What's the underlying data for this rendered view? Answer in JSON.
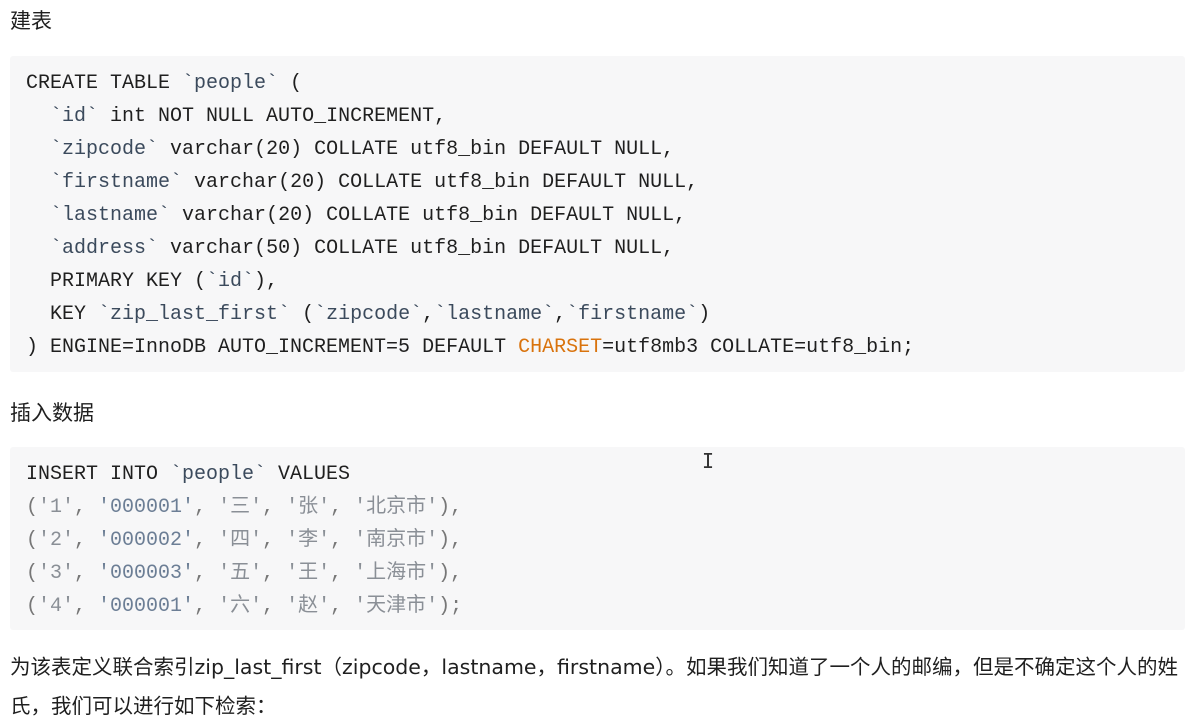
{
  "heading1": "建表",
  "code1": [
    [
      [
        "CREATE TABLE ",
        "k"
      ],
      [
        "`people`",
        "n"
      ],
      [
        " (",
        "k"
      ]
    ],
    [
      [
        "  ",
        "k"
      ],
      [
        "`id`",
        "n"
      ],
      [
        " int NOT NULL AUTO_INCREMENT,",
        "k"
      ]
    ],
    [
      [
        "  ",
        "k"
      ],
      [
        "`zipcode`",
        "n"
      ],
      [
        " varchar(20) COLLATE utf8_bin DEFAULT NULL,",
        "k"
      ]
    ],
    [
      [
        "  ",
        "k"
      ],
      [
        "`firstname`",
        "n"
      ],
      [
        " varchar(20) COLLATE utf8_bin DEFAULT NULL,",
        "k"
      ]
    ],
    [
      [
        "  ",
        "k"
      ],
      [
        "`lastname`",
        "n"
      ],
      [
        " varchar(20) COLLATE utf8_bin DEFAULT NULL,",
        "k"
      ]
    ],
    [
      [
        "  ",
        "k"
      ],
      [
        "`address`",
        "n"
      ],
      [
        " varchar(50) COLLATE utf8_bin DEFAULT NULL,",
        "k"
      ]
    ],
    [
      [
        "  PRIMARY KEY (",
        "k"
      ],
      [
        "`id`",
        "n"
      ],
      [
        "),",
        "k"
      ]
    ],
    [
      [
        "  KEY ",
        "k"
      ],
      [
        "`zip_last_first`",
        "n"
      ],
      [
        " (",
        "k"
      ],
      [
        "`zipcode`",
        "n"
      ],
      [
        ",",
        "k"
      ],
      [
        "`lastname`",
        "n"
      ],
      [
        ",",
        "k"
      ],
      [
        "`firstname`",
        "n"
      ],
      [
        ")",
        "k"
      ]
    ],
    [
      [
        ") ENGINE=InnoDB AUTO_INCREMENT=5 DEFAULT ",
        "k"
      ],
      [
        "CHARSET",
        "o"
      ],
      [
        "=utf8mb3 COLLATE=utf8_bin;",
        "k"
      ]
    ]
  ],
  "heading2": "插入数据",
  "code2": [
    [
      [
        "INSERT INTO ",
        "k"
      ],
      [
        "`people`",
        "n"
      ],
      [
        " VALUES",
        "k"
      ]
    ],
    [
      [
        "(",
        "p"
      ],
      [
        "'1'",
        "s"
      ],
      [
        ", ",
        "p"
      ],
      [
        "'000001'",
        "num"
      ],
      [
        ", ",
        "p"
      ],
      [
        "'三'",
        "s"
      ],
      [
        ", ",
        "p"
      ],
      [
        "'张'",
        "s"
      ],
      [
        ", ",
        "p"
      ],
      [
        "'北京市'",
        "s"
      ],
      [
        "),",
        "p"
      ]
    ],
    [
      [
        "(",
        "p"
      ],
      [
        "'2'",
        "s"
      ],
      [
        ", ",
        "p"
      ],
      [
        "'000002'",
        "num"
      ],
      [
        ", ",
        "p"
      ],
      [
        "'四'",
        "s"
      ],
      [
        ", ",
        "p"
      ],
      [
        "'李'",
        "s"
      ],
      [
        ", ",
        "p"
      ],
      [
        "'南京市'",
        "s"
      ],
      [
        "),",
        "p"
      ]
    ],
    [
      [
        "(",
        "p"
      ],
      [
        "'3'",
        "s"
      ],
      [
        ", ",
        "p"
      ],
      [
        "'000003'",
        "num"
      ],
      [
        ", ",
        "p"
      ],
      [
        "'五'",
        "s"
      ],
      [
        ", ",
        "p"
      ],
      [
        "'王'",
        "s"
      ],
      [
        ", ",
        "p"
      ],
      [
        "'上海市'",
        "s"
      ],
      [
        "),",
        "p"
      ]
    ],
    [
      [
        "(",
        "p"
      ],
      [
        "'4'",
        "s"
      ],
      [
        ", ",
        "p"
      ],
      [
        "'000001'",
        "num"
      ],
      [
        ", ",
        "p"
      ],
      [
        "'六'",
        "s"
      ],
      [
        ", ",
        "p"
      ],
      [
        "'赵'",
        "s"
      ],
      [
        ", ",
        "p"
      ],
      [
        "'天津市'",
        "s"
      ],
      [
        ");",
        "p"
      ]
    ]
  ],
  "paragraph": "为该表定义联合索引zip_last_first（zipcode，lastname，firstname）。如果我们知道了一个人的邮编，但是不确定这个人的姓氏，我们可以进行如下检索：",
  "cursor_glyph": "I",
  "colors": {
    "keyword": "#1f1f1f",
    "identifier": "#3b4a5c",
    "string": "#8a8f96",
    "charset_highlight": "#d9730d",
    "code_background": "#f7f7f8"
  }
}
